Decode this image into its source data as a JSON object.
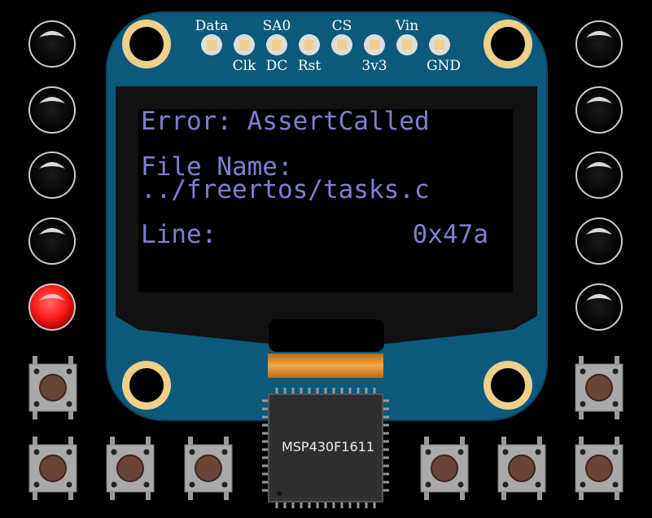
{
  "header_pins": {
    "top_labels": [
      "Data",
      "SA0",
      "CS",
      "Vin"
    ],
    "bottom_labels": [
      "Clk",
      "DC",
      "Rst",
      "3v3",
      "GND"
    ]
  },
  "oled": {
    "line1": "Error: AssertCalled",
    "line2": "File Name:",
    "line3": "../freertos/tasks.c",
    "line4_label": "Line:",
    "line4_value": "0x47a"
  },
  "chip": {
    "label": "MSP430F1611"
  },
  "leds": {
    "left": [
      "off",
      "off",
      "off",
      "off",
      "red"
    ],
    "right": [
      "off",
      "off",
      "off",
      "off",
      "off"
    ]
  },
  "colors": {
    "board": "#0b5a7c",
    "mount_ring": "#f0cf8a",
    "oled_text": "#7f7fcf",
    "led_red": "#ff1a1a",
    "flex_cable": "#e5952e"
  }
}
